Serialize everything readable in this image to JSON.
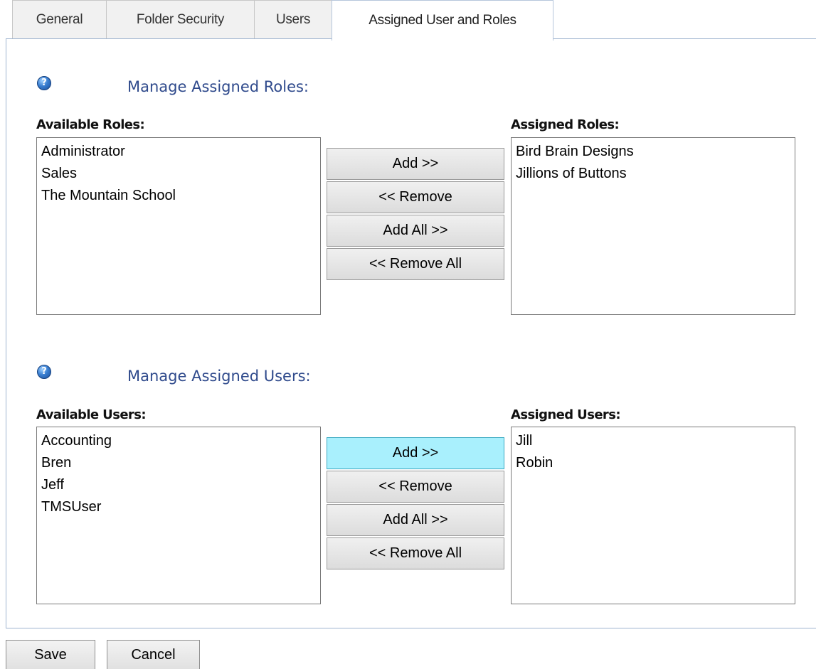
{
  "tabs": [
    {
      "label": "General"
    },
    {
      "label": "Folder Security"
    },
    {
      "label": "Users"
    },
    {
      "label": "Assigned User and Roles",
      "active": true
    }
  ],
  "roles": {
    "title": "Manage Assigned Roles:",
    "available_label": "Available Roles:",
    "assigned_label": "Assigned Roles:",
    "available": [
      "Administrator",
      "Sales",
      "The Mountain School"
    ],
    "assigned": [
      "Bird Brain Designs",
      "Jillions of Buttons"
    ],
    "buttons": {
      "add": "Add >>",
      "remove": "<< Remove",
      "add_all": "Add All >>",
      "remove_all": "<< Remove All"
    }
  },
  "users": {
    "title": "Manage Assigned Users:",
    "available_label": "Available Users:",
    "assigned_label": "Assigned Users:",
    "available": [
      "Accounting",
      "Bren",
      "Jeff",
      "TMSUser"
    ],
    "assigned": [
      "Jill",
      "Robin"
    ],
    "buttons": {
      "add": "Add >>",
      "remove": "<< Remove",
      "add_all": "Add All >>",
      "remove_all": "<< Remove All"
    }
  },
  "help_icon_glyph": "?",
  "footer": {
    "save": "Save",
    "cancel": "Cancel"
  },
  "colors": {
    "section_title": "#2f4a8c",
    "hover_button": "#a9f0fd",
    "panel_border": "#9fb4cf"
  }
}
